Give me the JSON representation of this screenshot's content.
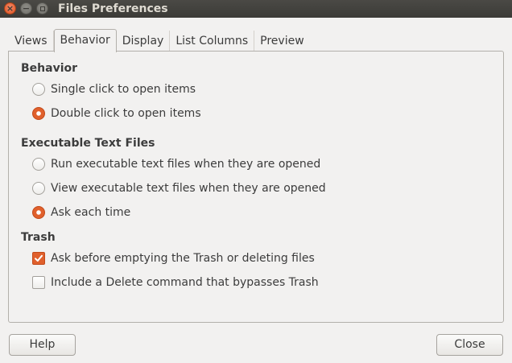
{
  "window": {
    "title": "Files Preferences",
    "controls": [
      "close-icon",
      "minimize-icon",
      "maximize-icon"
    ]
  },
  "tabs": [
    {
      "label": "Views",
      "active": false
    },
    {
      "label": "Behavior",
      "active": true
    },
    {
      "label": "Display",
      "active": false
    },
    {
      "label": "List Columns",
      "active": false
    },
    {
      "label": "Preview",
      "active": false
    }
  ],
  "behavior": {
    "title": "Behavior",
    "options": [
      {
        "label": "Single click to open items",
        "selected": false
      },
      {
        "label": "Double click to open items",
        "selected": true
      }
    ]
  },
  "executable": {
    "title": "Executable Text Files",
    "options": [
      {
        "label": "Run executable text files when they are opened",
        "selected": false
      },
      {
        "label": "View executable text files when they are opened",
        "selected": false
      },
      {
        "label": "Ask each time",
        "selected": true
      }
    ]
  },
  "trash": {
    "title": "Trash",
    "options": [
      {
        "label": "Ask before emptying the Trash or deleting files",
        "checked": true
      },
      {
        "label": "Include a Delete command that bypasses Trash",
        "checked": false
      }
    ]
  },
  "buttons": {
    "help": "Help",
    "close": "Close"
  },
  "colors": {
    "accent": "#e0602c",
    "titlebar": "#3c3b37",
    "background": "#f2f1f0"
  }
}
